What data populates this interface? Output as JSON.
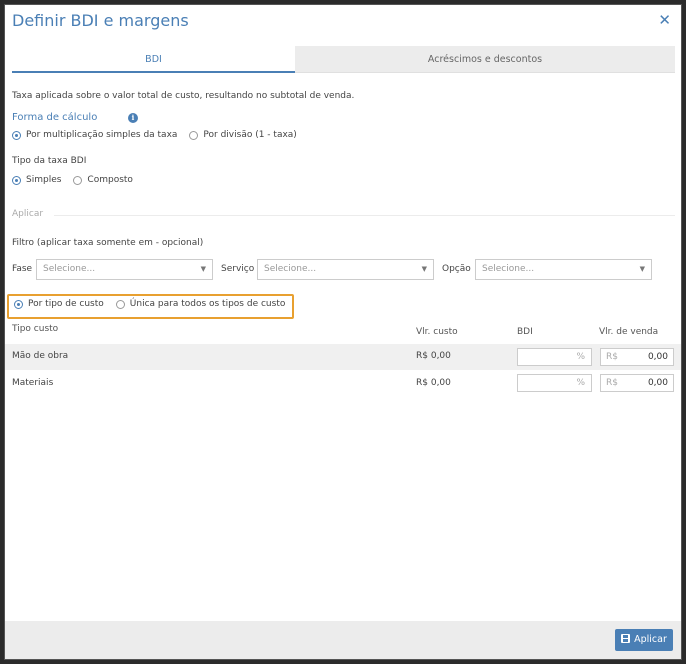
{
  "dialog": {
    "title": "Definir BDI e margens",
    "close_symbol": "✕"
  },
  "tabs": [
    {
      "label": "BDI",
      "active": true
    },
    {
      "label": "Acréscimos e descontos",
      "active": false
    }
  ],
  "description": "Taxa aplicada sobre o valor total de custo, resultando no subtotal de venda.",
  "calc_form": {
    "label": "Forma de cálculo",
    "info_symbol": "i",
    "options": [
      {
        "label": "Por multiplicação simples da taxa",
        "selected": true
      },
      {
        "label": "Por divisão (1 - taxa)",
        "selected": false
      }
    ]
  },
  "bdi_type": {
    "label": "Tipo da taxa BDI",
    "options": [
      {
        "label": "Simples",
        "selected": true
      },
      {
        "label": "Composto",
        "selected": false
      }
    ]
  },
  "apply_section": {
    "label": "Aplicar"
  },
  "filter": {
    "label": "Filtro (aplicar taxa somente em - opcional)",
    "fase": {
      "label": "Fase",
      "value": "Selecione..."
    },
    "servico": {
      "label": "Serviço",
      "value": "Selecione..."
    },
    "opcao": {
      "label": "Opção",
      "value": "Selecione..."
    },
    "caret": "▼"
  },
  "apply_mode": {
    "options": [
      {
        "label": "Por tipo de custo",
        "selected": true
      },
      {
        "label": "Única para todos os tipos de custo",
        "selected": false
      }
    ],
    "highlight_color": "#e8a030"
  },
  "table": {
    "headers": {
      "tipo": "Tipo custo",
      "custo": "Vlr. custo",
      "bdi": "BDI",
      "venda": "Vlr. de venda"
    },
    "rows": [
      {
        "tipo": "Mão de obra",
        "custo": "R$ 0,00",
        "bdi_unit": "%",
        "bdi_value": "",
        "venda_unit": "R$",
        "venda_value": "0,00"
      },
      {
        "tipo": "Materiais",
        "custo": "R$ 0,00",
        "bdi_unit": "%",
        "bdi_value": "",
        "venda_unit": "R$",
        "venda_value": "0,00"
      }
    ]
  },
  "footer": {
    "apply_label": "Aplicar",
    "apply_icon": "save-icon"
  },
  "colors": {
    "accent": "#4a7fb5",
    "tab_inactive": "#ececec"
  }
}
